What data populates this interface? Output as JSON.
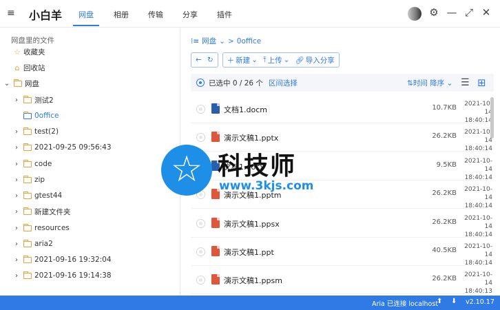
{
  "header": {
    "menu_icon": "≡",
    "app_title": "小白羊",
    "tabs": [
      {
        "label": "网盘",
        "active": true
      },
      {
        "label": "相册",
        "active": false
      },
      {
        "label": "传输",
        "active": false
      },
      {
        "label": "分享",
        "active": false
      },
      {
        "label": "插件",
        "active": false
      }
    ],
    "icons": {
      "settings": "⚙",
      "minimize": "—",
      "fullscreen": "⤢",
      "close": "✕"
    }
  },
  "sidebar": {
    "heading": "网盘里的文件",
    "items": [
      {
        "label": "收藏夹",
        "icon": "star-icon",
        "chevron": ""
      },
      {
        "label": "回收站",
        "icon": "trash-icon",
        "chevron": ""
      },
      {
        "label": "网盘",
        "icon": "folder-icon",
        "chevron": "⌄"
      },
      {
        "label": "测试2",
        "icon": "folder-icon",
        "chevron": "›"
      },
      {
        "label": "0office",
        "icon": "folder-icon",
        "chevron": "",
        "selected": true
      },
      {
        "label": "test(2)",
        "icon": "folder-icon",
        "chevron": "›"
      },
      {
        "label": "2021-09-25 09:56:43",
        "icon": "folder-icon",
        "chevron": "›"
      },
      {
        "label": "code",
        "icon": "folder-icon",
        "chevron": "›"
      },
      {
        "label": "zip",
        "icon": "folder-icon",
        "chevron": "›"
      },
      {
        "label": "gtest44",
        "icon": "folder-icon",
        "chevron": "›"
      },
      {
        "label": "新建文件夹",
        "icon": "folder-icon",
        "chevron": "›"
      },
      {
        "label": "resources",
        "icon": "folder-icon",
        "chevron": "›"
      },
      {
        "label": "aria2",
        "icon": "folder-icon",
        "chevron": "›"
      },
      {
        "label": "2021-09-16 19:32:04",
        "icon": "folder-icon",
        "chevron": "›"
      },
      {
        "label": "2021-09-16 19:14:38",
        "icon": "folder-icon",
        "chevron": "›"
      }
    ]
  },
  "breadcrumb": {
    "root": "网盘",
    "current": "0office"
  },
  "toolbar": {
    "back": "←",
    "refresh": "↻",
    "new_label": "新建",
    "upload_label": "上传",
    "import_share_label": "导入分享"
  },
  "selection": {
    "text": "已选中 0 / 26 个",
    "range_label": "区间选择",
    "sort_label": "时间 降序"
  },
  "files": [
    {
      "name": "文档1.docm",
      "type": "doc",
      "size": "10.7KB",
      "date": "2021-10-14",
      "time": "18:40:14"
    },
    {
      "name": "演示文稿1.pptx",
      "type": "ppt",
      "size": "26.2KB",
      "date": "2021-10-14",
      "time": "18:40:14"
    },
    {
      "name": "文档1.docx",
      "type": "doc",
      "size": "9.5KB",
      "date": "2021-10-14",
      "time": "18:40:14"
    },
    {
      "name": "演示文稿1.pptm",
      "type": "ppt",
      "size": "26.2KB",
      "date": "2021-10-14",
      "time": "18:40:14"
    },
    {
      "name": "演示文稿1.ppsx",
      "type": "ppt",
      "size": "26.2KB",
      "date": "2021-10-14",
      "time": "18:40:14"
    },
    {
      "name": "演示文稿1.ppt",
      "type": "ppt",
      "size": "40.5KB",
      "date": "2021-10-14",
      "time": "18:40:14"
    },
    {
      "name": "演示文稿1.ppsm",
      "type": "ppt",
      "size": "26.2KB",
      "date": "2021-10-14",
      "time": "18:40:13"
    }
  ],
  "watermark": {
    "text": "科技师",
    "url": "www.3kjs.com"
  },
  "status": {
    "aria": "Aria 已连接 localhost",
    "up": "⬆",
    "down": "⬇",
    "version": "v2.10.17"
  },
  "colors": {
    "accent": "#2f7ae5",
    "folder": "#e8a13b",
    "doc": "#2b5fad",
    "ppt": "#e0563a"
  }
}
